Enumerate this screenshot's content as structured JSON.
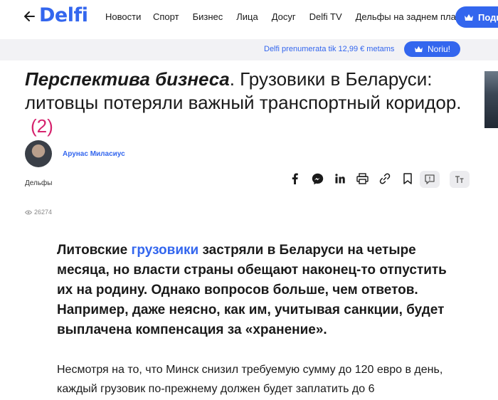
{
  "nav": {
    "logo": "Delfi",
    "links": [
      "Новости",
      "Спорт",
      "Бизнес",
      "Лица",
      "Досуг",
      "Delfi TV",
      "Дельфы на заднем плане"
    ],
    "subscribe_label": "Подп",
    "accent": "#3366ee"
  },
  "promo": {
    "text": "Delfi prenumerata tik 12,99 € metams",
    "button_label": "Noriu!"
  },
  "article": {
    "headline_lead": "Перспектива бизнеса",
    "headline_rest": ". Грузовики в Беларуси: литовцы потеряли важный транспортный коридор.",
    "comment_count": "(2)",
    "author": "Арунас Миласиус",
    "source": "Дельфы",
    "views": "26274",
    "lead_before": "Литовские ",
    "lead_keyword": "грузовики",
    "lead_after": " застряли в Беларуси на четыре месяца, но власти страны обещают наконец-то отпустить их на родину. Однако вопросов больше, чем ответов. Например, даже неясно, как им, учитывая санкции, будет выплачена компенсация за «хранение».",
    "para1": "Несмотря на то, что Минск снизил требуемую сумму до 120 евро в день, каждый грузовик по-прежнему должен будет заплатить до 6"
  },
  "share_icons": [
    "facebook-icon",
    "messenger-icon",
    "linkedin-icon",
    "print-icon",
    "link-icon",
    "bookmark-icon",
    "comment-icon",
    "text-size-icon"
  ]
}
